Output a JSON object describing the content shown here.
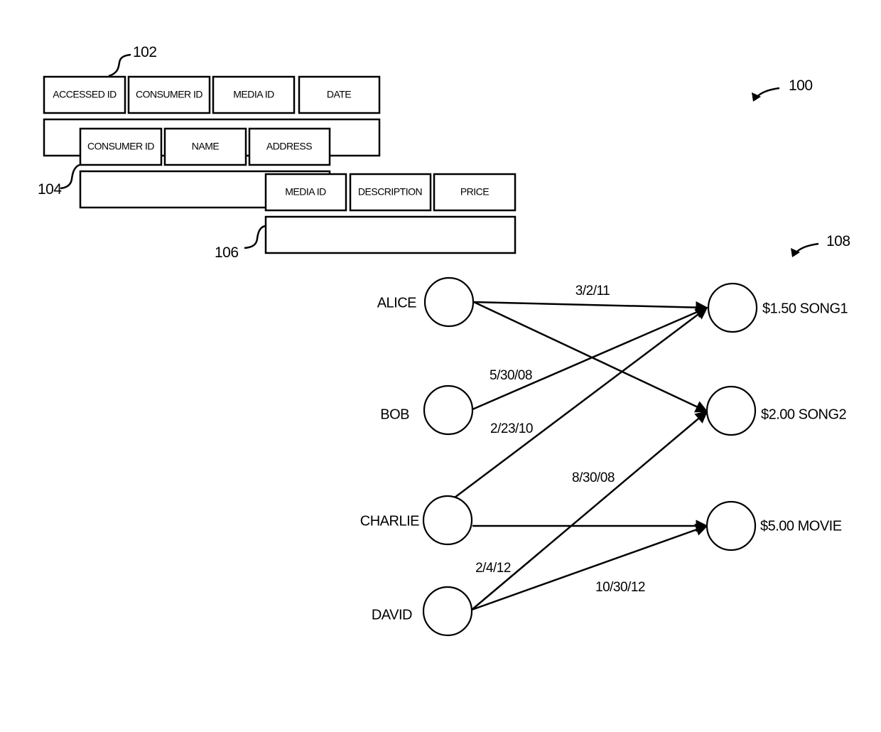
{
  "figure": {
    "ref_main": "100",
    "tables": {
      "accessed": {
        "ref": "102",
        "columns": [
          "ACCESSED ID",
          "CONSUMER ID",
          "MEDIA ID",
          "DATE"
        ]
      },
      "consumer": {
        "ref": "104",
        "columns": [
          "CONSUMER ID",
          "NAME",
          "ADDRESS"
        ]
      },
      "media": {
        "ref": "106",
        "columns": [
          "MEDIA ID",
          "DESCRIPTION",
          "PRICE"
        ]
      }
    },
    "graph": {
      "ref": "108",
      "consumers": [
        "ALICE",
        "BOB",
        "CHARLIE",
        "DAVID"
      ],
      "media": [
        "$1.50 SONG1",
        "$2.00 SONG2",
        "$5.00 MOVIE"
      ],
      "edges": [
        {
          "from": "ALICE",
          "to": "$1.50 SONG1",
          "label": "3/2/11"
        },
        {
          "from": "ALICE",
          "to": "$2.00 SONG2",
          "label": ""
        },
        {
          "from": "BOB",
          "to": "$1.50 SONG1",
          "label": "5/30/08"
        },
        {
          "from": "CHARLIE",
          "to": "$1.50 SONG1",
          "label": "2/23/10"
        },
        {
          "from": "CHARLIE",
          "to": "$5.00 MOVIE",
          "label": ""
        },
        {
          "from": "DAVID",
          "to": "$2.00 SONG2",
          "label": "8/30/08"
        },
        {
          "from": "DAVID",
          "to": "$5.00 MOVIE",
          "label": "10/30/12"
        }
      ],
      "extra_labels": [
        "2/4/12"
      ]
    }
  }
}
